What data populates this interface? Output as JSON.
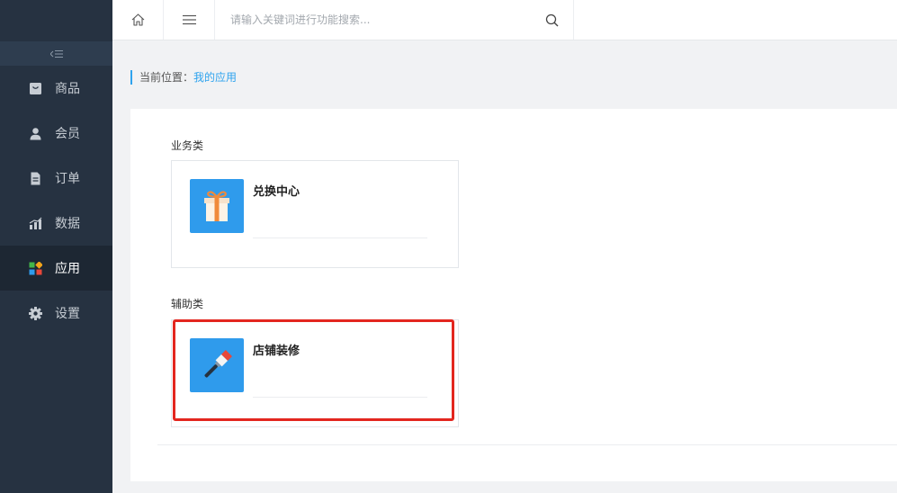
{
  "sidebar": {
    "collapse_icon": "collapse-menu-icon",
    "items": [
      {
        "label": "商品",
        "icon": "goods-icon",
        "active": false
      },
      {
        "label": "会员",
        "icon": "member-icon",
        "active": false
      },
      {
        "label": "订单",
        "icon": "order-icon",
        "active": false
      },
      {
        "label": "数据",
        "icon": "data-chart-icon",
        "active": false
      },
      {
        "label": "应用",
        "icon": "apps-icon",
        "active": true
      },
      {
        "label": "设置",
        "icon": "gear-icon",
        "active": false
      }
    ]
  },
  "topbar": {
    "home_icon": "home-icon",
    "menu_icon": "hamburger-menu-icon",
    "search": {
      "value": "",
      "placeholder": "请输入关键词进行功能搜索...",
      "icon": "search-icon"
    }
  },
  "breadcrumb": {
    "prefix": "当前位置：",
    "current": "我的应用"
  },
  "sections": [
    {
      "title": "业务类",
      "apps": [
        {
          "name": "兑换中心",
          "icon": "gift-icon"
        }
      ]
    },
    {
      "title": "辅助类",
      "apps": [
        {
          "name": "店铺装修",
          "icon": "paint-brush-icon"
        }
      ]
    }
  ],
  "colors": {
    "sidebar_bg": "#263241",
    "sidebar_active_bg": "#1d2733",
    "accent": "#2ea3ee",
    "app_icon_bg": "#2f9bec",
    "highlight": "#e3261f"
  }
}
